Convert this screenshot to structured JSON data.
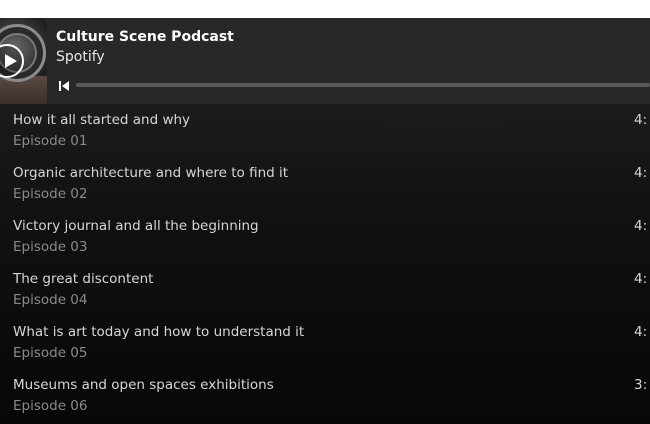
{
  "podcast": {
    "title": "Culture Scene Podcast",
    "platform": "Spotify",
    "progress_fraction": 0.0,
    "icons": {
      "play": "play-icon",
      "previous": "skip-previous-icon"
    }
  },
  "episodes": [
    {
      "title": "How it all started and why",
      "number": "Episode 01",
      "duration": "4:"
    },
    {
      "title": "Organic architecture and where to find it",
      "number": "Episode 02",
      "duration": "4:"
    },
    {
      "title": "Victory journal and all the beginning",
      "number": "Episode 03",
      "duration": "4:"
    },
    {
      "title": "The great discontent",
      "number": "Episode 04",
      "duration": "4:"
    },
    {
      "title": "What is art today and how to understand it",
      "number": "Episode 05",
      "duration": "4:"
    },
    {
      "title": "Museums and open spaces exhibitions",
      "number": "Episode 06",
      "duration": "3:"
    }
  ],
  "colors": {
    "header_bg": "#282828",
    "text_primary": "#ffffff",
    "text_secondary": "#8a8a8a"
  }
}
